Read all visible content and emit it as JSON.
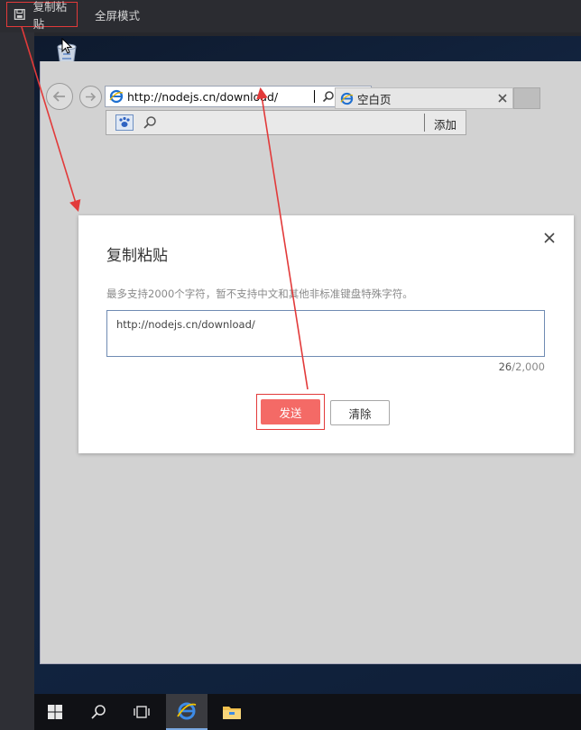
{
  "toolbar": {
    "copy_paste_label": "复制粘贴",
    "fullscreen_label": "全屏模式"
  },
  "browser": {
    "address_url": "http://nodejs.cn/download/",
    "tab_title": "空白页",
    "search_add_label": "添加"
  },
  "modal": {
    "title": "复制粘贴",
    "hint": "最多支持2000个字符，暂不支持中文和其他非标准键盘特殊字符。",
    "textarea_value": "http://nodejs.cn/download/",
    "counter_current": "26",
    "counter_max": "/2,000",
    "send_label": "发送",
    "clear_label": "清除"
  },
  "colors": {
    "highlight_red": "#e23a3a",
    "send_button": "#f46a66",
    "toolbar_bg": "#2b2c31",
    "ie_blue": "#1e6fd0"
  },
  "icons": {
    "toolbar_copy": "clipboard-icon",
    "modal_close": "close-icon",
    "taskbar": [
      "windows-start-icon",
      "search-icon",
      "task-view-icon",
      "internet-explorer-icon",
      "file-explorer-icon"
    ]
  }
}
